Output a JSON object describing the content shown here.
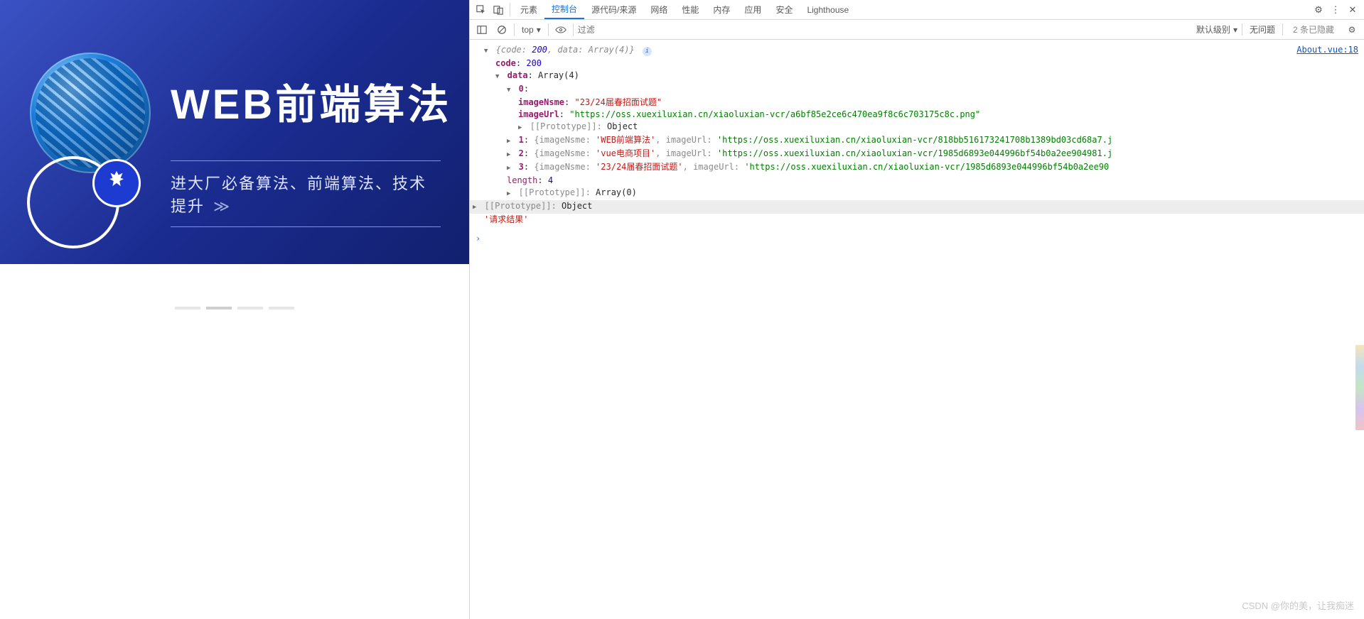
{
  "hero": {
    "title": "WEB前端算法",
    "subtitle": "进大厂必备算法、前端算法、技术提升",
    "arrows": "≫"
  },
  "tabs": {
    "elements": "元素",
    "console": "控制台",
    "sources": "源代码/来源",
    "network": "网络",
    "performance": "性能",
    "memory": "内存",
    "application": "应用",
    "security": "安全",
    "lighthouse": "Lighthouse"
  },
  "toolbar": {
    "context": "top",
    "filter_placeholder": "过滤",
    "levels": "默认级别",
    "no_problems": "无问题",
    "hidden": "2 条已隐藏"
  },
  "source_link": "About.vue:18",
  "obj": {
    "summary_prefix": "{code: ",
    "code_val": "200",
    "summary_mid": ", data: ",
    "summary_arr": "Array(4)",
    "summary_suffix": "}",
    "code_label": "code",
    "code_value": "200",
    "data_label": "data",
    "data_header": "Array(4)",
    "item0": {
      "idx": "0",
      "imageNsme_label": "imageNsme",
      "imageNsme_value": "\"23/24届春招面试题\"",
      "imageUrl_label": "imageUrl",
      "imageUrl_value": "\"https://oss.xuexiluxian.cn/xiaoluxian-vcr/a6bf85e2ce6c470ea9f8c6c703175c8c.png\"",
      "proto_label": "[[Prototype]]",
      "proto_value": "Object"
    },
    "item1": {
      "idx": "1",
      "line": "{imageNsme: 'WEB前端算法', imageUrl: 'https://oss.xuexiluxian.cn/xiaoluxian-vcr/818bb516173241708b1389bd03cd68a7.j"
    },
    "item2": {
      "idx": "2",
      "line": "{imageNsme: 'vue电商项目', imageUrl: 'https://oss.xuexiluxian.cn/xiaoluxian-vcr/1985d6893e044996bf54b0a2ee904981.j"
    },
    "item3": {
      "idx": "3",
      "line": "{imageNsme: '23/24届春招面试题', imageUrl: 'https://oss.xuexiluxian.cn/xiaoluxian-vcr/1985d6893e044996bf54b0a2ee90"
    },
    "length_label": "length",
    "length_value": "4",
    "arr_proto_label": "[[Prototype]]",
    "arr_proto_value": "Array(0)",
    "outer_proto_label": "[[Prototype]]",
    "outer_proto_value": "Object"
  },
  "trailing_string": "'请求结果'",
  "watermark": "CSDN @你的美，让我痴迷"
}
